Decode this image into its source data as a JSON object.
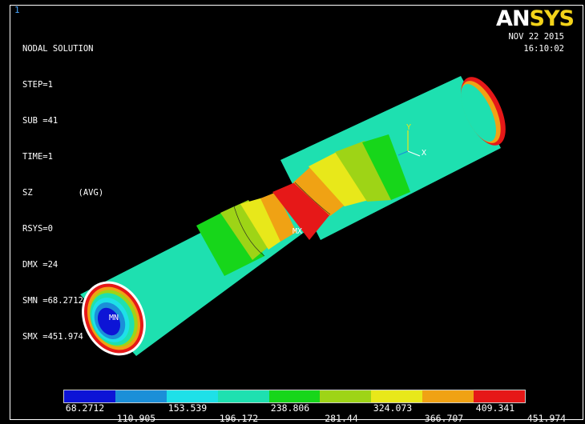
{
  "window_number": "1",
  "title": "NODAL SOLUTION",
  "info_lines": [
    "STEP=1",
    "SUB =41",
    "TIME=1",
    "SZ         (AVG)",
    "RSYS=0",
    "DMX =24",
    "SMN =68.2712",
    "SMX =451.974"
  ],
  "logo": {
    "an": "AN",
    "sys": "SYS"
  },
  "date": "NOV 22 2015",
  "time": "16:10:02",
  "model_labels": {
    "mx": "MX",
    "mn": "MN"
  },
  "triad": {
    "y": "Y",
    "x": "X"
  },
  "legend": {
    "colors": [
      "#0d14d6",
      "#1b8fd8",
      "#1ee0e8",
      "#1ee0b0",
      "#17d61a",
      "#9ed416",
      "#e8e81a",
      "#f0a214",
      "#e61818"
    ],
    "top_labels": [
      "68.2712",
      "153.539",
      "238.806",
      "324.073",
      "409.341"
    ],
    "bottom_labels": [
      "110.905",
      "196.172",
      "281.44",
      "366.707",
      "451.974"
    ]
  }
}
